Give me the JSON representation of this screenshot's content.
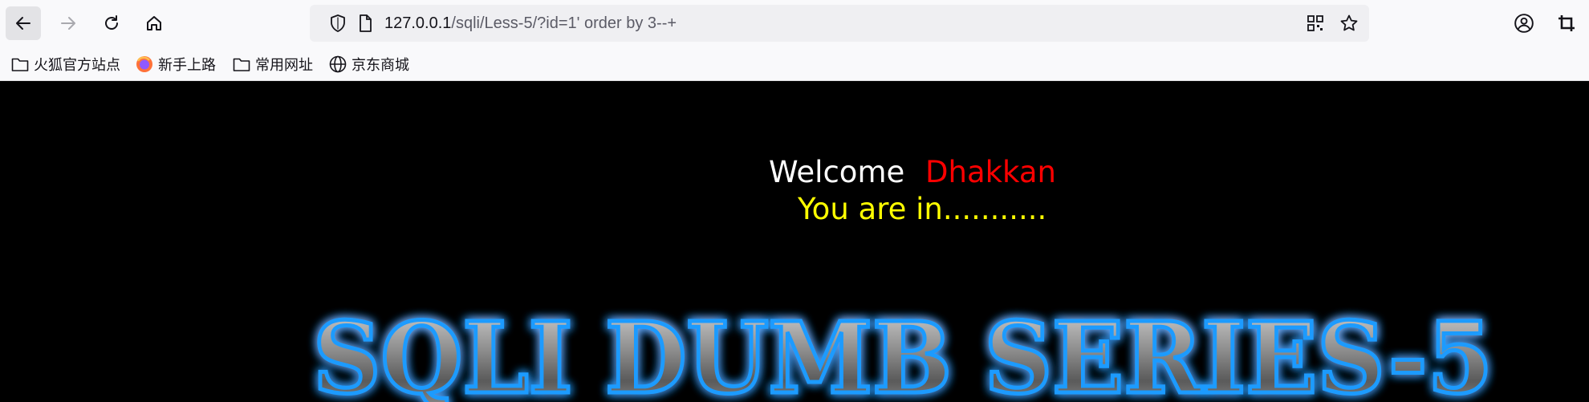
{
  "browser": {
    "url_host": "127.0.0.1",
    "url_path": "/sqli/Less-5/?id=1' order by 3--+"
  },
  "bookmarks": [
    {
      "label": "火狐官方站点",
      "icon": "folder-icon"
    },
    {
      "label": "新手上路",
      "icon": "firefox-icon"
    },
    {
      "label": "常用网址",
      "icon": "folder-icon"
    },
    {
      "label": "京东商城",
      "icon": "globe-icon"
    }
  ],
  "page": {
    "welcome_label": "Welcome",
    "username": "Dhakkan",
    "status": "You are in...........",
    "banner_text": "SQLI DUMB SERIES-5"
  },
  "colors": {
    "welcome": "#ffffff",
    "username": "#ff0000",
    "status": "#ffff00",
    "banner_glow": "#1e9bff"
  }
}
